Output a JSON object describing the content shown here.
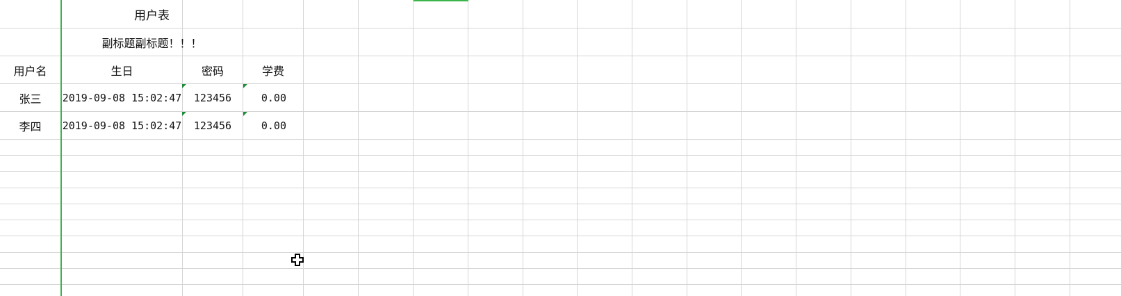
{
  "sheet": {
    "title": "用户表",
    "subtitle": "副标题副标题！！！",
    "headers": {
      "username": "用户名",
      "birthday": "生日",
      "password": "密码",
      "tuition": "学费"
    },
    "rows": [
      {
        "username": "张三",
        "birthday": "2019-09-08 15:02:47",
        "password": "123456",
        "tuition": "0.00"
      },
      {
        "username": "李四",
        "birthday": "2019-09-08 15:02:47",
        "password": "123456",
        "tuition": "0.00"
      }
    ]
  },
  "colors": {
    "grid": "#d4d4d4",
    "selection_border": "#3bb54a",
    "number_as_text_marker": "#1e8a3a"
  },
  "cursor": {
    "icon": "cross-cursor-icon"
  }
}
